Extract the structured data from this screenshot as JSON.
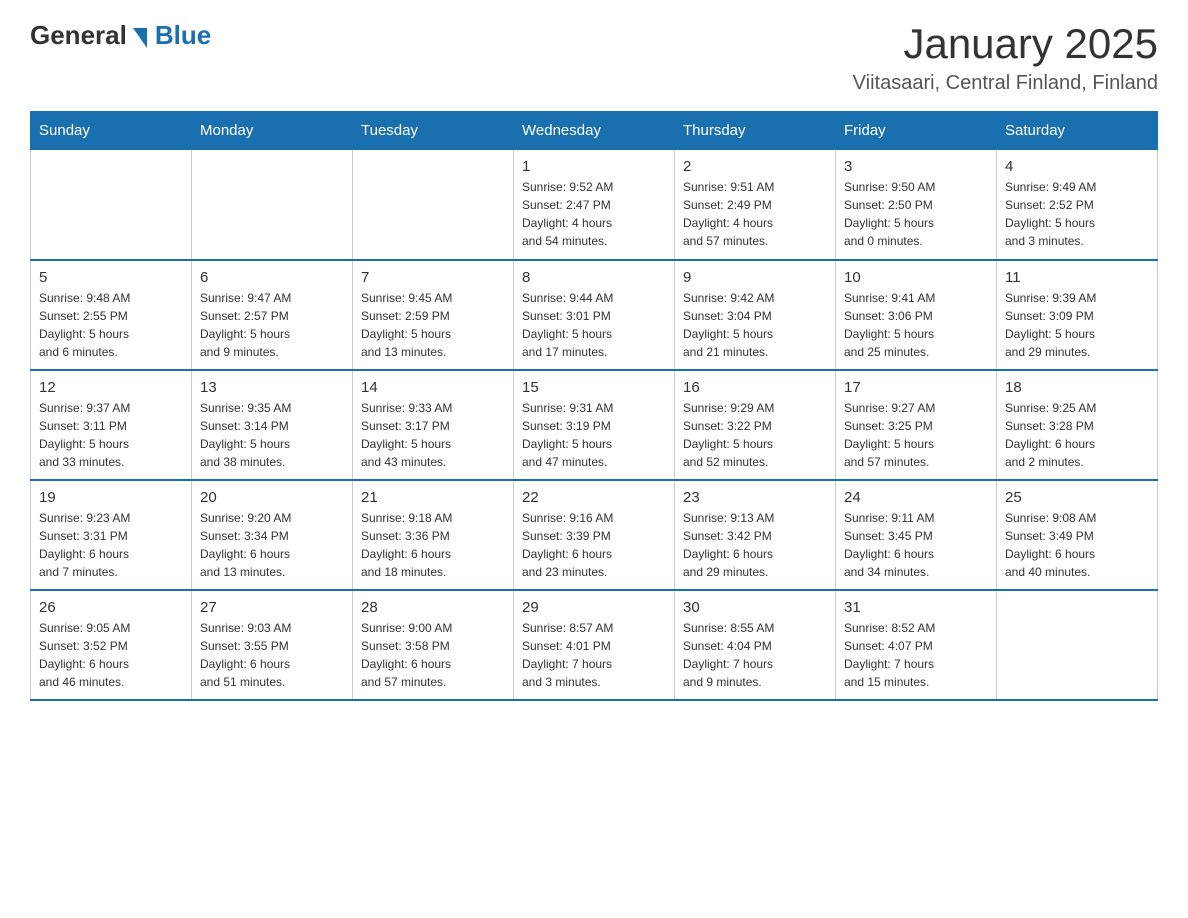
{
  "header": {
    "logo_general": "General",
    "logo_blue": "Blue",
    "month_title": "January 2025",
    "location": "Viitasaari, Central Finland, Finland"
  },
  "days_of_week": [
    "Sunday",
    "Monday",
    "Tuesday",
    "Wednesday",
    "Thursday",
    "Friday",
    "Saturday"
  ],
  "weeks": [
    [
      {
        "day": "",
        "info": ""
      },
      {
        "day": "",
        "info": ""
      },
      {
        "day": "",
        "info": ""
      },
      {
        "day": "1",
        "info": "Sunrise: 9:52 AM\nSunset: 2:47 PM\nDaylight: 4 hours\nand 54 minutes."
      },
      {
        "day": "2",
        "info": "Sunrise: 9:51 AM\nSunset: 2:49 PM\nDaylight: 4 hours\nand 57 minutes."
      },
      {
        "day": "3",
        "info": "Sunrise: 9:50 AM\nSunset: 2:50 PM\nDaylight: 5 hours\nand 0 minutes."
      },
      {
        "day": "4",
        "info": "Sunrise: 9:49 AM\nSunset: 2:52 PM\nDaylight: 5 hours\nand 3 minutes."
      }
    ],
    [
      {
        "day": "5",
        "info": "Sunrise: 9:48 AM\nSunset: 2:55 PM\nDaylight: 5 hours\nand 6 minutes."
      },
      {
        "day": "6",
        "info": "Sunrise: 9:47 AM\nSunset: 2:57 PM\nDaylight: 5 hours\nand 9 minutes."
      },
      {
        "day": "7",
        "info": "Sunrise: 9:45 AM\nSunset: 2:59 PM\nDaylight: 5 hours\nand 13 minutes."
      },
      {
        "day": "8",
        "info": "Sunrise: 9:44 AM\nSunset: 3:01 PM\nDaylight: 5 hours\nand 17 minutes."
      },
      {
        "day": "9",
        "info": "Sunrise: 9:42 AM\nSunset: 3:04 PM\nDaylight: 5 hours\nand 21 minutes."
      },
      {
        "day": "10",
        "info": "Sunrise: 9:41 AM\nSunset: 3:06 PM\nDaylight: 5 hours\nand 25 minutes."
      },
      {
        "day": "11",
        "info": "Sunrise: 9:39 AM\nSunset: 3:09 PM\nDaylight: 5 hours\nand 29 minutes."
      }
    ],
    [
      {
        "day": "12",
        "info": "Sunrise: 9:37 AM\nSunset: 3:11 PM\nDaylight: 5 hours\nand 33 minutes."
      },
      {
        "day": "13",
        "info": "Sunrise: 9:35 AM\nSunset: 3:14 PM\nDaylight: 5 hours\nand 38 minutes."
      },
      {
        "day": "14",
        "info": "Sunrise: 9:33 AM\nSunset: 3:17 PM\nDaylight: 5 hours\nand 43 minutes."
      },
      {
        "day": "15",
        "info": "Sunrise: 9:31 AM\nSunset: 3:19 PM\nDaylight: 5 hours\nand 47 minutes."
      },
      {
        "day": "16",
        "info": "Sunrise: 9:29 AM\nSunset: 3:22 PM\nDaylight: 5 hours\nand 52 minutes."
      },
      {
        "day": "17",
        "info": "Sunrise: 9:27 AM\nSunset: 3:25 PM\nDaylight: 5 hours\nand 57 minutes."
      },
      {
        "day": "18",
        "info": "Sunrise: 9:25 AM\nSunset: 3:28 PM\nDaylight: 6 hours\nand 2 minutes."
      }
    ],
    [
      {
        "day": "19",
        "info": "Sunrise: 9:23 AM\nSunset: 3:31 PM\nDaylight: 6 hours\nand 7 minutes."
      },
      {
        "day": "20",
        "info": "Sunrise: 9:20 AM\nSunset: 3:34 PM\nDaylight: 6 hours\nand 13 minutes."
      },
      {
        "day": "21",
        "info": "Sunrise: 9:18 AM\nSunset: 3:36 PM\nDaylight: 6 hours\nand 18 minutes."
      },
      {
        "day": "22",
        "info": "Sunrise: 9:16 AM\nSunset: 3:39 PM\nDaylight: 6 hours\nand 23 minutes."
      },
      {
        "day": "23",
        "info": "Sunrise: 9:13 AM\nSunset: 3:42 PM\nDaylight: 6 hours\nand 29 minutes."
      },
      {
        "day": "24",
        "info": "Sunrise: 9:11 AM\nSunset: 3:45 PM\nDaylight: 6 hours\nand 34 minutes."
      },
      {
        "day": "25",
        "info": "Sunrise: 9:08 AM\nSunset: 3:49 PM\nDaylight: 6 hours\nand 40 minutes."
      }
    ],
    [
      {
        "day": "26",
        "info": "Sunrise: 9:05 AM\nSunset: 3:52 PM\nDaylight: 6 hours\nand 46 minutes."
      },
      {
        "day": "27",
        "info": "Sunrise: 9:03 AM\nSunset: 3:55 PM\nDaylight: 6 hours\nand 51 minutes."
      },
      {
        "day": "28",
        "info": "Sunrise: 9:00 AM\nSunset: 3:58 PM\nDaylight: 6 hours\nand 57 minutes."
      },
      {
        "day": "29",
        "info": "Sunrise: 8:57 AM\nSunset: 4:01 PM\nDaylight: 7 hours\nand 3 minutes."
      },
      {
        "day": "30",
        "info": "Sunrise: 8:55 AM\nSunset: 4:04 PM\nDaylight: 7 hours\nand 9 minutes."
      },
      {
        "day": "31",
        "info": "Sunrise: 8:52 AM\nSunset: 4:07 PM\nDaylight: 7 hours\nand 15 minutes."
      },
      {
        "day": "",
        "info": ""
      }
    ]
  ]
}
